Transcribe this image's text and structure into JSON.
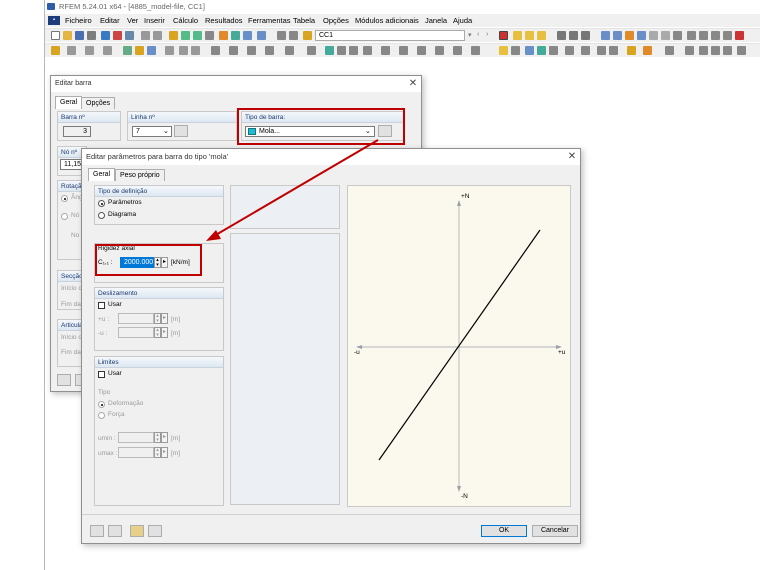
{
  "app": {
    "title": "RFEM 5.24.01 x64 - [4885_model-file, CC1]",
    "menu": [
      "Ficheiro",
      "Editar",
      "Ver",
      "Inserir",
      "Cálculo",
      "Resultados",
      "Ferramentas",
      "Tabela",
      "Opções",
      "Módulos adicionais",
      "Janela",
      "Ajuda"
    ],
    "loadcase": "CC1"
  },
  "edit_member": {
    "title": "Editar barra",
    "tabs": [
      "Geral",
      "Opções"
    ],
    "member_no_label": "Barra nº",
    "member_no": "3",
    "line_no_label": "Linha nº",
    "line_no": "7",
    "member_type_label": "Tipo de barra:",
    "member_type": "Mola...",
    "node_no_label": "Nó nº",
    "node_no": "11,15",
    "rotation_label": "Rotação",
    "rotation_opt1": "Âng",
    "rotation_opt2": "Nó",
    "rotation_no": "No",
    "section_label": "Secção",
    "section_start": "Início c",
    "section_end": "Fim da",
    "hinge_label": "Articula",
    "hinge_start": "Início c",
    "hinge_end": "Fim da"
  },
  "spring_dialog": {
    "title": "Editar parâmetros para barra do tipo 'mola'",
    "tabs": [
      "Geral",
      "Peso próprio"
    ],
    "definition": {
      "header": "Tipo de definição",
      "options": [
        "Parâmetros",
        "Diagrama"
      ],
      "selected": "Parâmetros"
    },
    "axial": {
      "header": "Rigidez axial",
      "label": "C₁,₁ :",
      "value": "2000.000",
      "unit": "[kN/m]"
    },
    "slip": {
      "header": "Deslizamento",
      "use": "Usar",
      "plus_label": "+u :",
      "minus_label": "-u :",
      "unit": "[m]"
    },
    "limits": {
      "header": "Limites",
      "use": "Usar",
      "type_label": "Tipo",
      "options": [
        "Deformação",
        "Força"
      ],
      "umin_label": "umin :",
      "umax_label": "umax :",
      "unit": "[m]"
    },
    "diagram": {
      "plus_n": "+N",
      "minus_n": "-N",
      "minus_u": "-u",
      "plus_u": "+u"
    },
    "ok": "OK",
    "cancel": "Cancelar"
  },
  "colors": {
    "highlight_red": "#c00000",
    "selection_blue": "#0078d7",
    "group_header_text": "#1a3a6e",
    "diagram_background": "#fbf8ee",
    "mola_icon": "#22b8d8"
  }
}
